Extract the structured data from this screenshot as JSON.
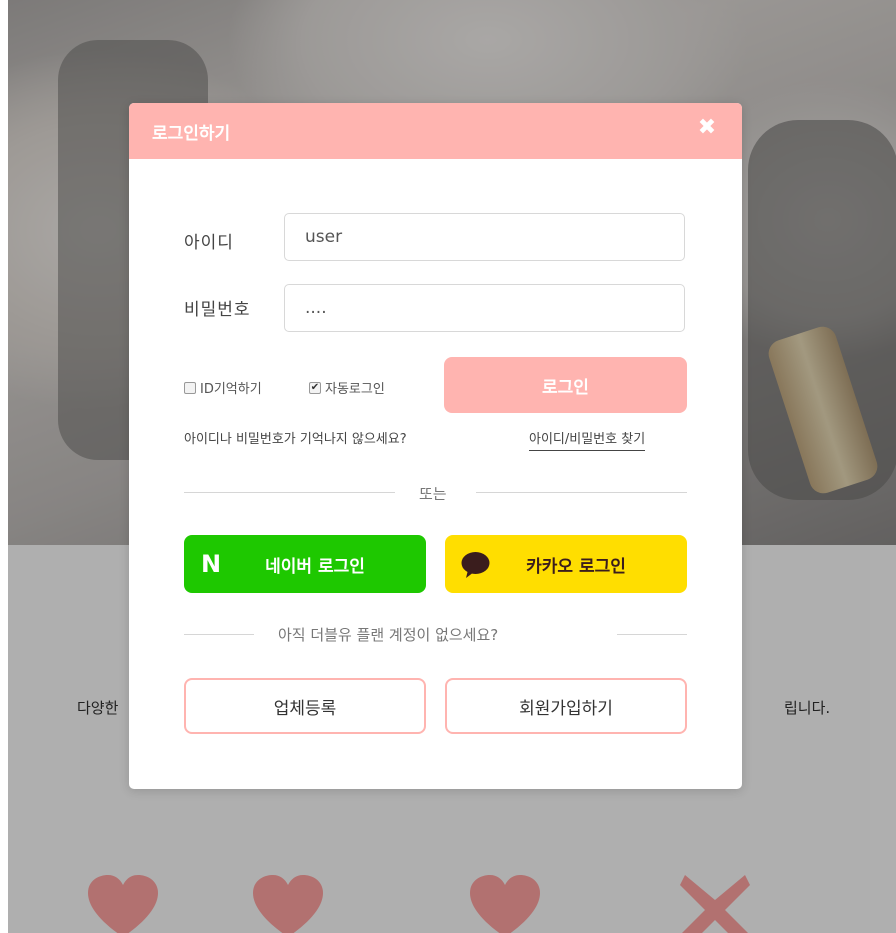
{
  "modal": {
    "title": "로그인하기",
    "close_icon": "close-icon",
    "id_label": "아이디",
    "id_value": "user",
    "pw_label": "비밀번호",
    "pw_value": "....",
    "remember_id_label": "ID기억하기",
    "remember_id_checked": false,
    "auto_login_label": "자동로그인",
    "auto_login_checked": true,
    "login_button": "로그인",
    "forgot_text": "아이디나 비밀번호가 기억나지 않으세요?",
    "forgot_link": "아이디/비밀번호 찾기",
    "or_text": "또는",
    "naver_icon_letter": "N",
    "naver_button": "네이버 로그인",
    "kakao_icon": "speech-bubble-icon",
    "kakao_button": "카카오 로그인",
    "no_account_text": "아직 더블유 플랜 계정이 없으세요?",
    "company_register_button": "업체등록",
    "signup_button": "회원가입하기"
  },
  "background": {
    "left_text": "다양한",
    "right_text": "립니다."
  },
  "colors": {
    "accent": "#ffb4b0",
    "naver": "#1ec800",
    "kakao": "#ffde00",
    "heart": "#b27170"
  }
}
